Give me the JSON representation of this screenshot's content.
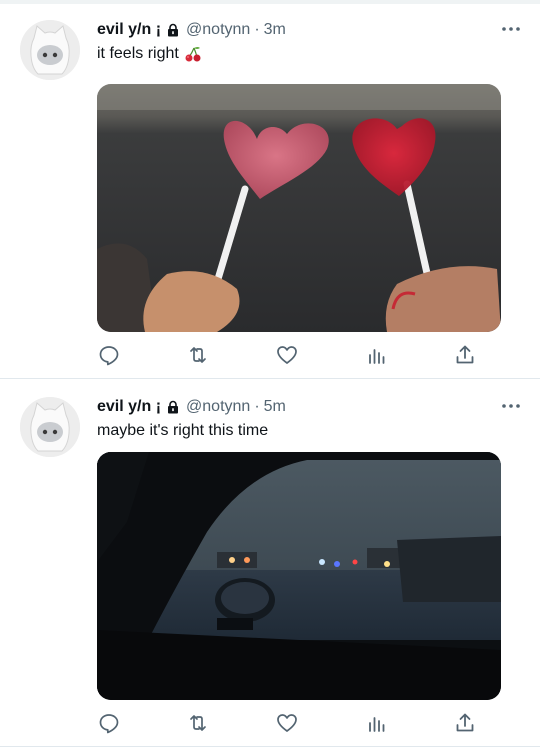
{
  "tweets": [
    {
      "display_name": "evil y/n ¡",
      "handle": "@notynn",
      "separator": "·",
      "time": "3m",
      "text": "it feels right",
      "emoji": "cherries-emoji",
      "media_alt": "two heart-shaped lollipops held up against a dark background"
    },
    {
      "display_name": "evil y/n ¡",
      "handle": "@notynn",
      "separator": "·",
      "time": "5m",
      "text": "maybe it's right this time",
      "media_alt": "rainy car window at night with blurred city lights"
    }
  ],
  "icons": {
    "avatar": "cat-hood-avatar",
    "lock": "lock-icon",
    "more": "more-icon",
    "reply": "reply-icon",
    "retweet": "retweet-icon",
    "like": "heart-icon",
    "views": "analytics-icon",
    "share": "share-icon"
  },
  "colors": {
    "text_primary": "#0f1419",
    "text_secondary": "#536471",
    "divider": "#e1e8ed"
  }
}
